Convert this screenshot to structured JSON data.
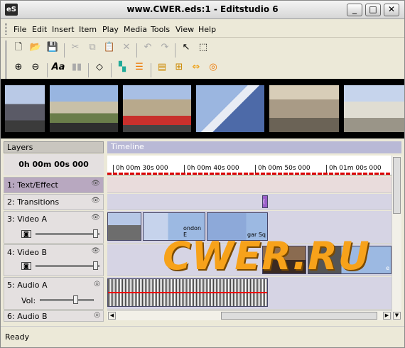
{
  "window": {
    "title": "www.CWER.eds:1 - Editstudio 6",
    "app_icon_label": "eS"
  },
  "menu": [
    "File",
    "Edit",
    "Insert",
    "Item",
    "Play",
    "Media",
    "Tools",
    "View",
    "Help"
  ],
  "panels": {
    "layers_title": "Layers",
    "timeline_title": "Timeline",
    "timecode": "0h 00m 00s 000"
  },
  "ruler": {
    "ticks": [
      "0h 00m 30s 000",
      "0h 00m 40s 000",
      "0h 00m 50s 000",
      "0h 01m 00s 000"
    ]
  },
  "layers": [
    {
      "label": "1: Text/Effect"
    },
    {
      "label": "2: Transitions"
    },
    {
      "label": "3: Video A"
    },
    {
      "label": "4: Video B"
    },
    {
      "label": "5: Audio A",
      "vol_label": "Vol:"
    },
    {
      "label": "6: Audio B"
    }
  ],
  "clips": {
    "video_a": [
      "",
      "ondon E",
      "gar Sq"
    ],
    "video_b": [
      "",
      "e"
    ],
    "transition_label": "("
  },
  "watermark": "CWER.RU",
  "status": "Ready",
  "colors": {
    "text_track": "#e9dcdc",
    "clip_blue": "#9cb9e2",
    "transition": "#9a5fc9"
  }
}
